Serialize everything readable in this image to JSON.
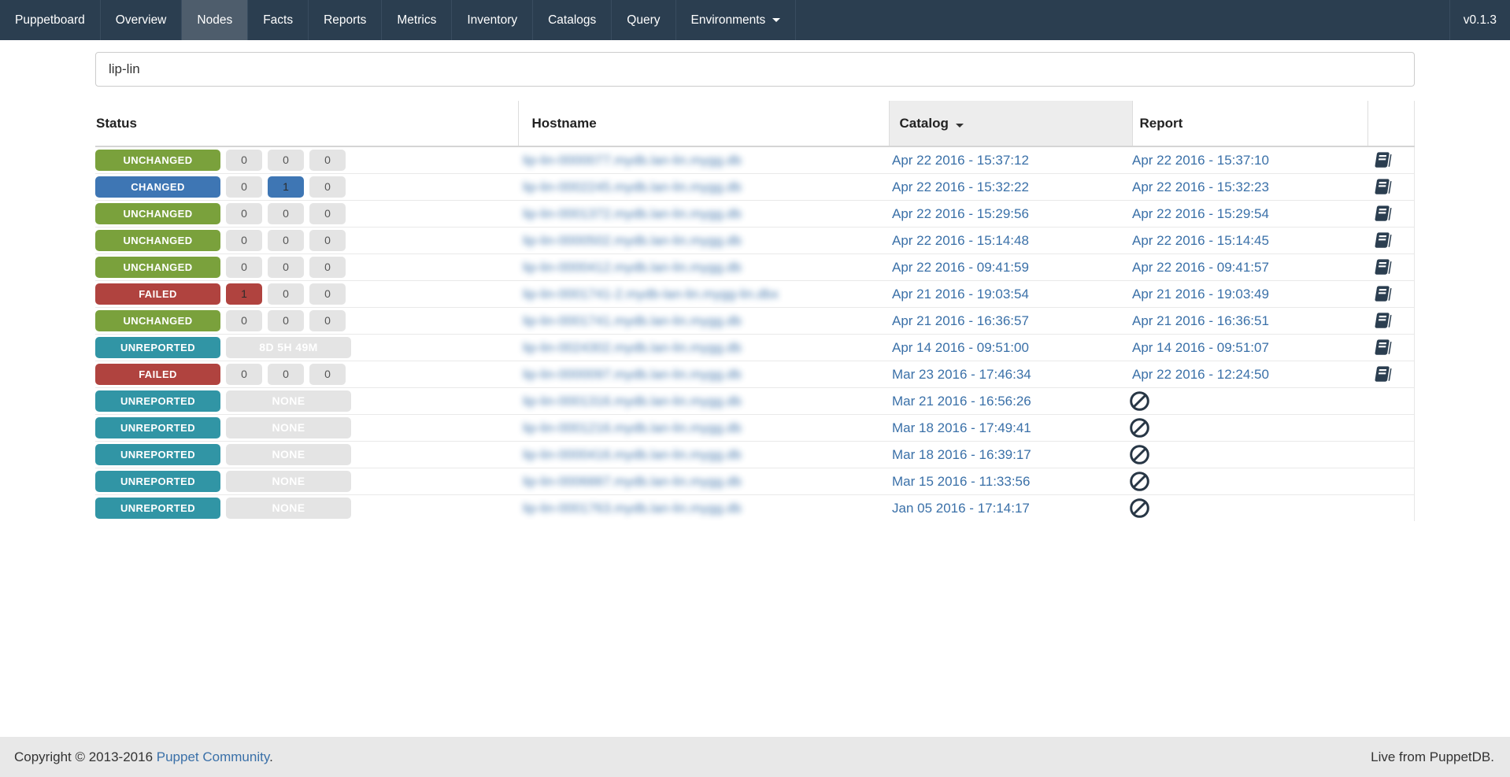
{
  "navbar": {
    "brand": "Puppetboard",
    "items": [
      {
        "label": "Overview"
      },
      {
        "label": "Nodes"
      },
      {
        "label": "Facts"
      },
      {
        "label": "Reports"
      },
      {
        "label": "Metrics"
      },
      {
        "label": "Inventory"
      },
      {
        "label": "Catalogs"
      },
      {
        "label": "Query"
      },
      {
        "label": "Environments",
        "has_caret": true
      }
    ],
    "active": "Nodes",
    "version": "v0.1.3"
  },
  "search": {
    "value": "lip-lin",
    "placeholder": ""
  },
  "table": {
    "columns": {
      "status": "Status",
      "hostname": "Hostname",
      "catalog": "Catalog",
      "report": "Report"
    },
    "sorted_column": "Catalog",
    "sort_direction": "desc",
    "rows": [
      {
        "status": {
          "label": "UNCHANGED",
          "key": "unchanged"
        },
        "counters": {
          "values": [
            "0",
            "0",
            "0"
          ],
          "accent_index": null
        },
        "hostname_blurred": "lip-lin-0000077.mydb.lan-lin.mygg.db",
        "catalog": "Apr 22 2016 - 15:37:12",
        "report": "Apr 22 2016 - 15:37:10",
        "has_report_doc": true
      },
      {
        "status": {
          "label": "CHANGED",
          "key": "changed"
        },
        "counters": {
          "values": [
            "0",
            "1",
            "0"
          ],
          "accent_index": 1
        },
        "hostname_blurred": "lip-lin-0002245.mydb.lan-lin.mygg.db",
        "catalog": "Apr 22 2016 - 15:32:22",
        "report": "Apr 22 2016 - 15:32:23",
        "has_report_doc": true
      },
      {
        "status": {
          "label": "UNCHANGED",
          "key": "unchanged"
        },
        "counters": {
          "values": [
            "0",
            "0",
            "0"
          ],
          "accent_index": null
        },
        "hostname_blurred": "lip-lin-0001372.mydb.lan-lin.mygg.db",
        "catalog": "Apr 22 2016 - 15:29:56",
        "report": "Apr 22 2016 - 15:29:54",
        "has_report_doc": true
      },
      {
        "status": {
          "label": "UNCHANGED",
          "key": "unchanged"
        },
        "counters": {
          "values": [
            "0",
            "0",
            "0"
          ],
          "accent_index": null
        },
        "hostname_blurred": "lip-lin-0000502.mydb.lan-lin.mygg.db",
        "catalog": "Apr 22 2016 - 15:14:48",
        "report": "Apr 22 2016 - 15:14:45",
        "has_report_doc": true
      },
      {
        "status": {
          "label": "UNCHANGED",
          "key": "unchanged"
        },
        "counters": {
          "values": [
            "0",
            "0",
            "0"
          ],
          "accent_index": null
        },
        "hostname_blurred": "lip-lin-0000412.mydb.lan-lin.mygg.db",
        "catalog": "Apr 22 2016 - 09:41:59",
        "report": "Apr 22 2016 - 09:41:57",
        "has_report_doc": true
      },
      {
        "status": {
          "label": "FAILED",
          "key": "failed"
        },
        "counters": {
          "values": [
            "1",
            "0",
            "0"
          ],
          "accent_index": 0
        },
        "hostname_blurred": "lip-lin-0001741-2.mydb-lan-lin.mygg-lin.dbx",
        "catalog": "Apr 21 2016 - 19:03:54",
        "report": "Apr 21 2016 - 19:03:49",
        "has_report_doc": true
      },
      {
        "status": {
          "label": "UNCHANGED",
          "key": "unchanged"
        },
        "counters": {
          "values": [
            "0",
            "0",
            "0"
          ],
          "accent_index": null
        },
        "hostname_blurred": "lip-lin-0001741.mydb.lan-lin.mygg.db",
        "catalog": "Apr 21 2016 - 16:36:57",
        "report": "Apr 21 2016 - 16:36:51",
        "has_report_doc": true
      },
      {
        "status": {
          "label": "UNREPORTED",
          "key": "unreported"
        },
        "counters": {
          "wide_label": "8D 5H 49M"
        },
        "hostname_blurred": "lip-lin-0024302.mydb.lan-lin.mygg.db",
        "catalog": "Apr 14 2016 - 09:51:00",
        "report": "Apr 14 2016 - 09:51:07",
        "has_report_doc": true
      },
      {
        "status": {
          "label": "FAILED",
          "key": "failed"
        },
        "counters": {
          "values": [
            "0",
            "0",
            "0"
          ],
          "accent_index": null
        },
        "hostname_blurred": "lip-lin-0000097.mydb.lan-lin.mygg.db",
        "catalog": "Mar 23 2016 - 17:46:34",
        "report": "Apr 22 2016 - 12:24:50",
        "has_report_doc": true
      },
      {
        "status": {
          "label": "UNREPORTED",
          "key": "unreported"
        },
        "counters": {
          "wide_label": "NONE"
        },
        "hostname_blurred": "lip-lin-0001316.mydb.lan-lin.mygg.db",
        "catalog": "Mar 21 2016 - 16:56:26",
        "report": null,
        "has_report_doc": false
      },
      {
        "status": {
          "label": "UNREPORTED",
          "key": "unreported"
        },
        "counters": {
          "wide_label": "NONE"
        },
        "hostname_blurred": "lip-lin-0001216.mydb.lan-lin.mygg.db",
        "catalog": "Mar 18 2016 - 17:49:41",
        "report": null,
        "has_report_doc": false
      },
      {
        "status": {
          "label": "UNREPORTED",
          "key": "unreported"
        },
        "counters": {
          "wide_label": "NONE"
        },
        "hostname_blurred": "lip-lin-0000416.mydb.lan-lin.mygg.db",
        "catalog": "Mar 18 2016 - 16:39:17",
        "report": null,
        "has_report_doc": false
      },
      {
        "status": {
          "label": "UNREPORTED",
          "key": "unreported"
        },
        "counters": {
          "wide_label": "NONE"
        },
        "hostname_blurred": "lip-lin-0006887.mydb.lan-lin.mygg.db",
        "catalog": "Mar 15 2016 - 11:33:56",
        "report": null,
        "has_report_doc": false
      },
      {
        "status": {
          "label": "UNREPORTED",
          "key": "unreported"
        },
        "counters": {
          "wide_label": "NONE"
        },
        "hostname_blurred": "lip-lin-0001763.mydb.lan-lin.mygg.db",
        "catalog": "Jan 05 2016 - 17:14:17",
        "report": null,
        "has_report_doc": false
      }
    ]
  },
  "footer": {
    "copyright_prefix": "Copyright © 2013-2016 ",
    "copyright_link": "Puppet Community",
    "copyright_suffix": ".",
    "right_text": "Live from PuppetDB."
  },
  "colors": {
    "navbar_bg": "#2b3e50",
    "navbar_active_bg": "#4e5d6c",
    "status_unchanged": "#7aa13c",
    "status_changed": "#3e76b4",
    "status_failed": "#b0433f",
    "status_unreported": "#3195a5",
    "link": "#3a70a8",
    "pill_bg": "#e4e4e4",
    "footer_bg": "#e8e8e8",
    "icon_dark": "#2b3e50"
  },
  "icons": {
    "report_doc": "book-icon",
    "no_report": "ban-icon",
    "sort": "caret-down-icon"
  }
}
